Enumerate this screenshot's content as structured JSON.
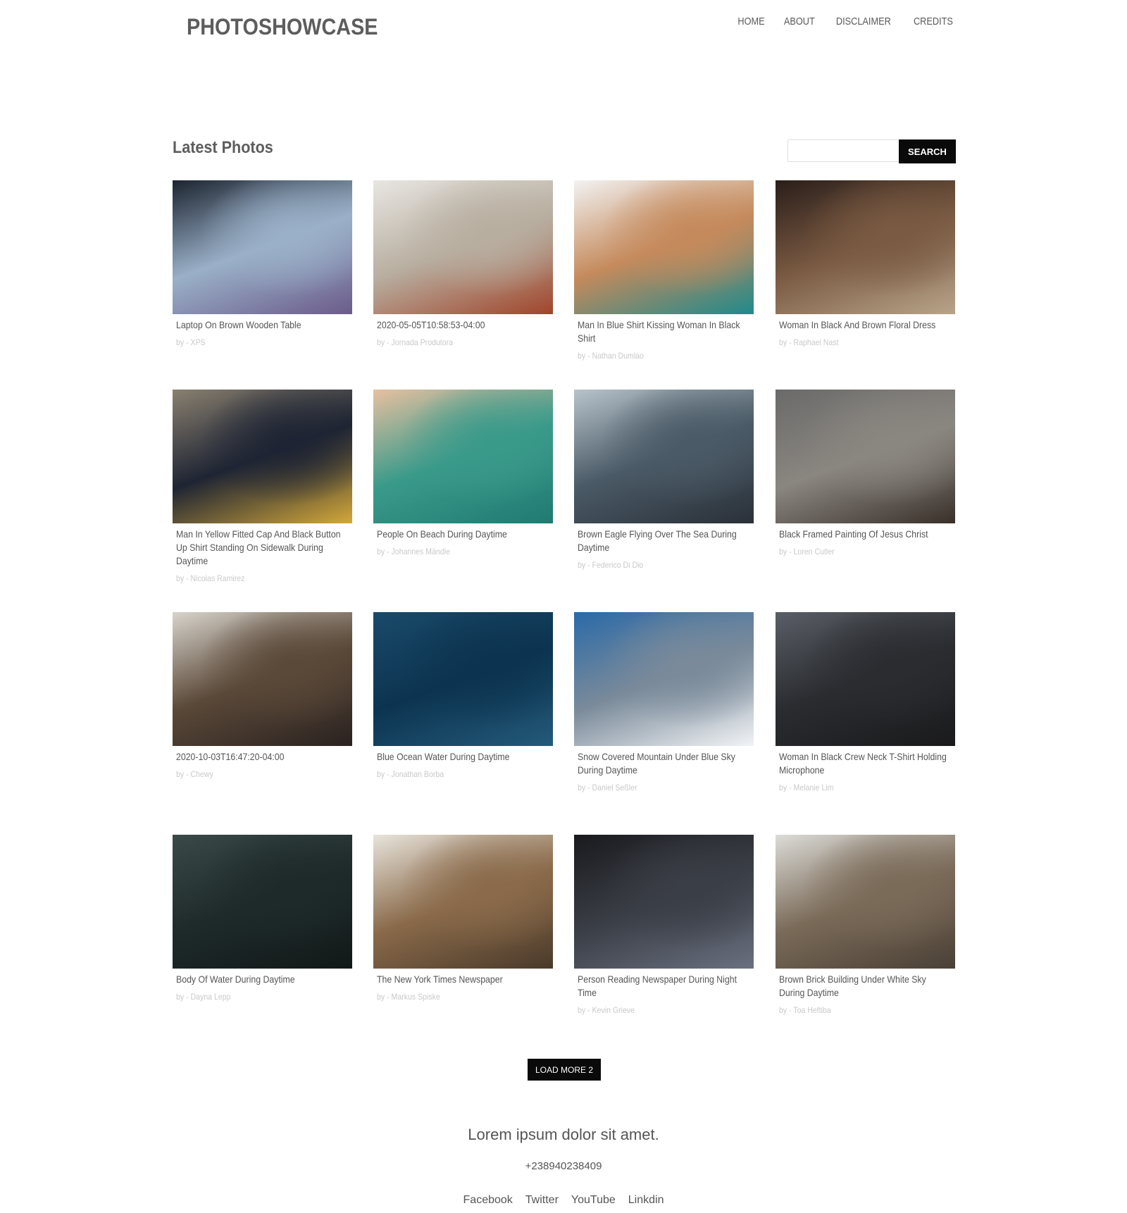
{
  "header": {
    "logo": "PHOTOSHOWCASE",
    "nav": [
      "HOME",
      "ABOUT",
      "DISCLAIMER",
      "CREDITS"
    ]
  },
  "section": {
    "title": "Latest Photos",
    "search_placeholder": "",
    "search_button": "SEARCH"
  },
  "photos": [
    {
      "title": "Laptop On Brown Wooden Table",
      "author": "by - XPS",
      "colors": [
        "#1c2430",
        "#9ab0c8",
        "#6b5b8a"
      ]
    },
    {
      "title": "2020-05-05T10:58:53-04:00",
      "author": "by - Jornada Produtora",
      "colors": [
        "#e8e6e2",
        "#b8aea0",
        "#a0452a"
      ]
    },
    {
      "title": "Man In Blue Shirt Kissing Woman In Black Shirt",
      "author": "by - Nathan Dumlao",
      "colors": [
        "#f2f2f2",
        "#c58a5c",
        "#1f8a8c"
      ]
    },
    {
      "title": "Woman In Black And Brown Floral Dress",
      "author": "by - Raphael Nast",
      "colors": [
        "#2a1e1a",
        "#7a5a42",
        "#b8a48a"
      ]
    },
    {
      "title": "Man In Yellow Fitted Cap And Black Button Up Shirt Standing On Sidewalk During Daytime",
      "author": "by - Nicolas Ramirez",
      "colors": [
        "#8a8070",
        "#1e2433",
        "#d4a83a"
      ]
    },
    {
      "title": "People On Beach During Daytime",
      "author": "by - Johannes Mändle",
      "colors": [
        "#e8c0a0",
        "#3a9a8a",
        "#207a72"
      ]
    },
    {
      "title": "Brown Eagle Flying Over The Sea During Daytime",
      "author": "by - Federico Di Dio",
      "colors": [
        "#b8c4cc",
        "#4a5a66",
        "#2a3038"
      ]
    },
    {
      "title": "Black Framed Painting Of Jesus Christ",
      "author": "by - Loren Cutler",
      "colors": [
        "#6a6a6a",
        "#8a8680",
        "#3a302a"
      ]
    },
    {
      "title": "2020-10-03T16:47:20-04:00",
      "author": "by - Chewy",
      "colors": [
        "#d8d4cc",
        "#5a4838",
        "#2a2220"
      ]
    },
    {
      "title": "Blue Ocean Water During Daytime",
      "author": "by - Jonathan Borba",
      "colors": [
        "#1a4a6a",
        "#0c3450",
        "#245a7a"
      ]
    },
    {
      "title": "Snow Covered Mountain Under Blue Sky During Daytime",
      "author": "by - Daniel Seßler",
      "colors": [
        "#2a6aa8",
        "#7a8a9a",
        "#f2f4f6"
      ]
    },
    {
      "title": "Woman In Black Crew Neck T-Shirt Holding Microphone",
      "author": "by - Melanie Lim",
      "colors": [
        "#5a5e66",
        "#2a2c30",
        "#1a1a1c"
      ]
    },
    {
      "title": "Body Of Water During Daytime",
      "author": "by - Dayna Lepp",
      "colors": [
        "#3a4a48",
        "#1e2a2a",
        "#121818"
      ]
    },
    {
      "title": "The New York Times Newspaper",
      "author": "by - Markus Spiske",
      "colors": [
        "#e8e4dc",
        "#8a6a4a",
        "#4a3a2a"
      ]
    },
    {
      "title": "Person Reading Newspaper During Night Time",
      "author": "by - Kevin Grieve",
      "colors": [
        "#1a1a1e",
        "#3a3e46",
        "#6a7080"
      ]
    },
    {
      "title": "Brown Brick Building Under White Sky During Daytime",
      "author": "by - Toa Heftiba",
      "colors": [
        "#dcdcd8",
        "#7a6a58",
        "#4a4036"
      ]
    }
  ],
  "load_more": "LOAD MORE 2",
  "footer": {
    "tagline": "Lorem ipsum dolor sit amet.",
    "phone": "+238940238409",
    "links": [
      "Facebook",
      "Twitter",
      "YouTube",
      "Linkdin"
    ]
  }
}
